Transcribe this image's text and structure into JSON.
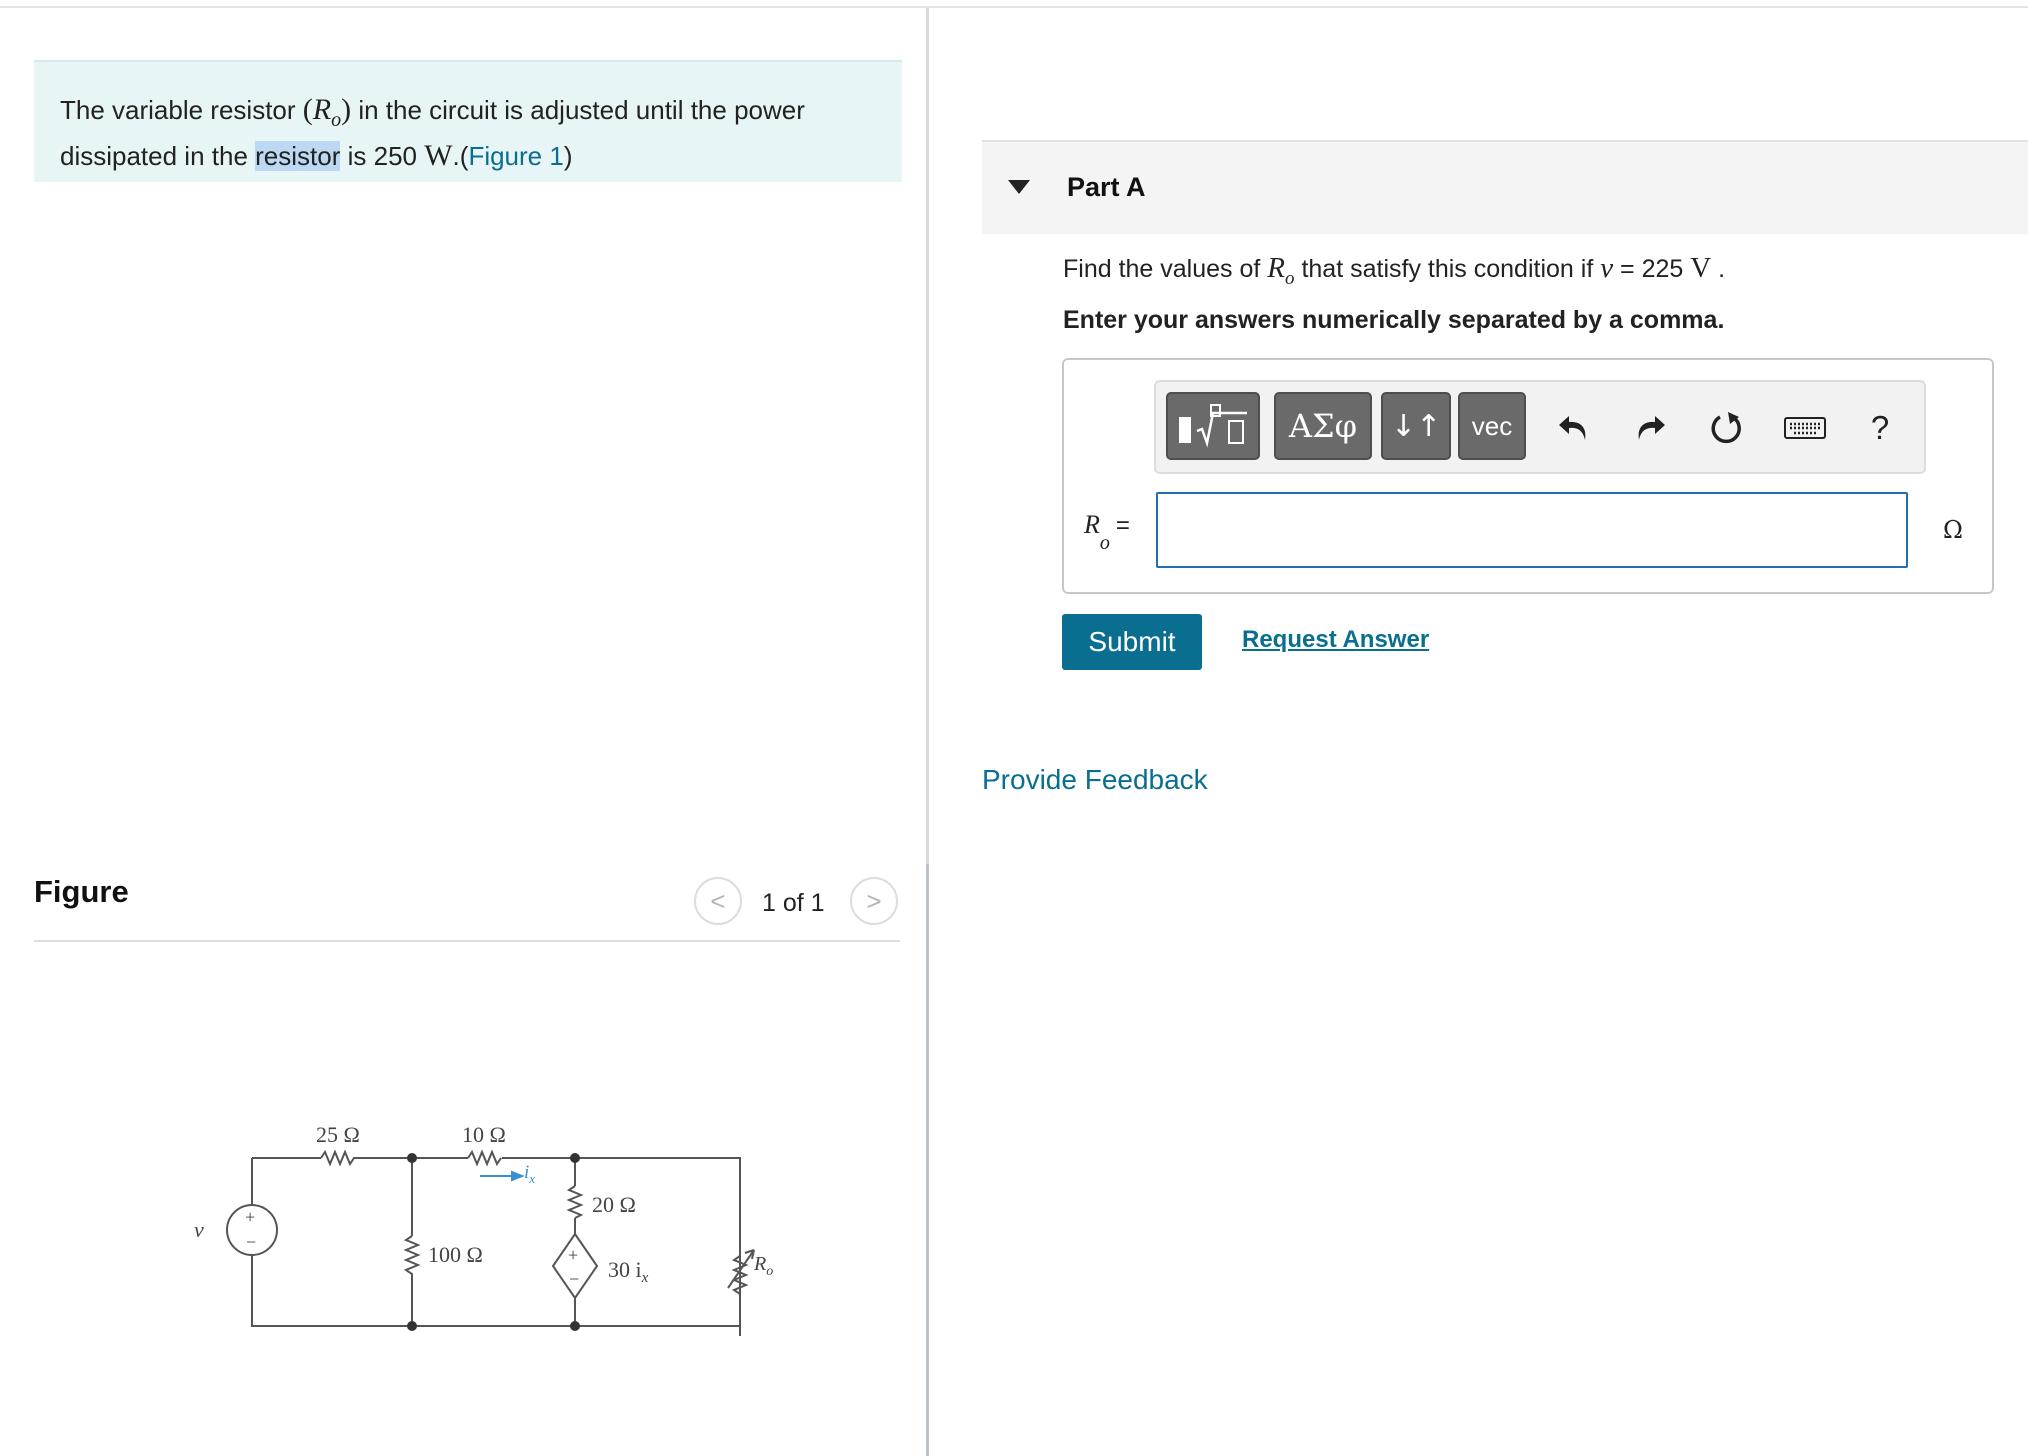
{
  "problem": {
    "text_1": "The variable resistor ",
    "symbol_open": "(",
    "symbol_var": "R",
    "symbol_sub": "o",
    "symbol_close": ")",
    "text_2": " in the circuit is adjusted until the power",
    "text_3": "dissipated in the ",
    "highlighted_word": "resistor",
    "text_4": " is 250 ",
    "unit": "W",
    "text_5": ".(",
    "figure_link": "Figure 1",
    "text_6": ")"
  },
  "figure": {
    "title": "Figure",
    "counter": "1 of 1",
    "prev_icon": "chevron-left-icon",
    "next_icon": "chevron-right-icon",
    "prev_glyph": "<",
    "next_glyph": ">",
    "circuit_labels": {
      "r1": "25 Ω",
      "r2": "10 Ω",
      "r3": "100 Ω",
      "r4": "20 Ω",
      "dependent_source": "30 i",
      "dependent_source_sub": "x",
      "current": "i",
      "current_sub": "x",
      "source": "v",
      "variable_resistor": "R",
      "variable_resistor_sub": "o",
      "plus": "+",
      "minus": "−"
    }
  },
  "part_a": {
    "title": "Part A",
    "question_1": "Find the values of ",
    "question_var": "R",
    "question_sub": "o",
    "question_2": " that satisfy this condition if ",
    "question_v": "v",
    "question_3": " = 225 ",
    "question_unit": "V",
    "question_4": " .",
    "instruction": "Enter your answers numerically separated by a comma.",
    "toolbar": {
      "greek_label": "ΑΣφ",
      "arrows_label": "↓↑",
      "vec_label": "vec",
      "help_label": "?"
    },
    "input_label_var": "R",
    "input_label_sub": "o",
    "input_label_eq": "=",
    "input_value": "",
    "unit": "Ω",
    "submit_label": "Submit",
    "request_label": "Request Answer"
  },
  "feedback_label": "Provide Feedback"
}
